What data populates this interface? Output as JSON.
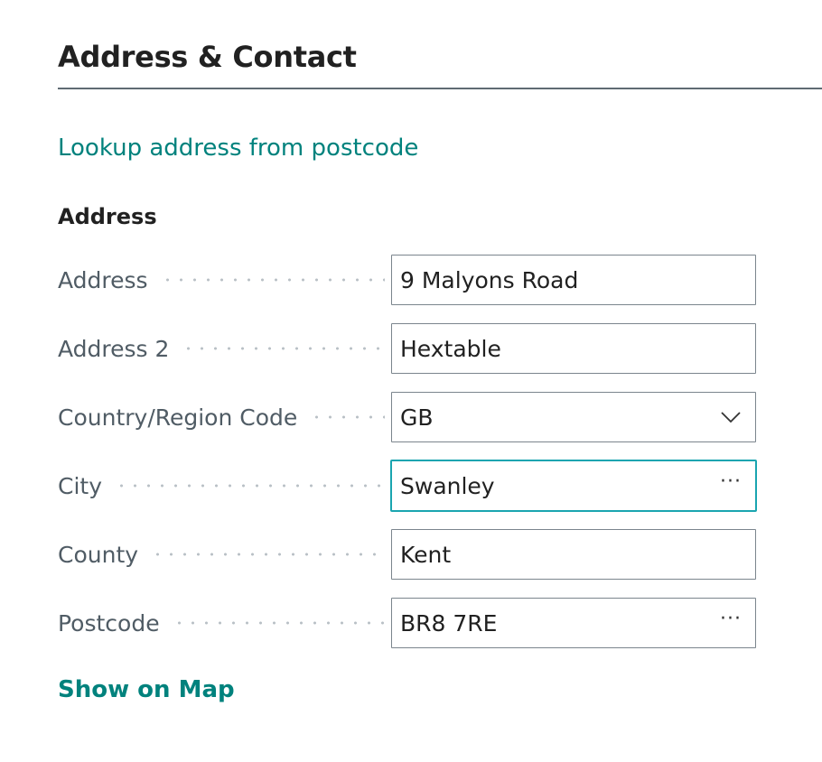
{
  "section": {
    "title": "Address & Contact"
  },
  "lookup_link": "Lookup address from postcode",
  "group_heading": "Address",
  "fields": [
    {
      "label": "Address",
      "value": "9 Malyons Road"
    },
    {
      "label": "Address 2",
      "value": "Hextable"
    },
    {
      "label": "Country/Region Code",
      "value": "GB",
      "icon": "chevron-down-icon"
    },
    {
      "label": "City",
      "value": "Swanley",
      "icon": "ellipsis-icon",
      "focused": true
    },
    {
      "label": "County",
      "value": "Kent"
    },
    {
      "label": "Postcode",
      "value": "BR8 7RE",
      "icon": "ellipsis-icon"
    }
  ],
  "show_on_map_link": "Show on Map",
  "colors": {
    "link": "#00827d",
    "focus_border": "#1aa5b0",
    "label": "#505c65",
    "input_border": "#7b858d"
  }
}
